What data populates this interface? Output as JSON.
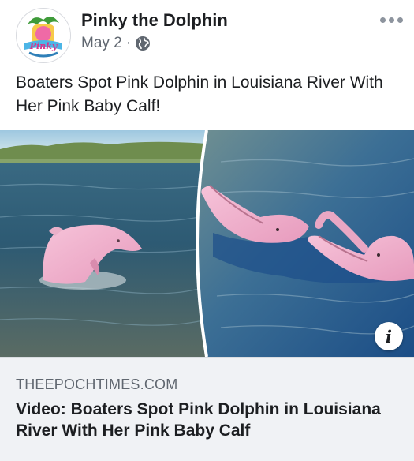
{
  "post": {
    "author": "Pinky the Dolphin",
    "date": "May 2",
    "separator": "·",
    "privacy_icon": "globe-icon",
    "more_icon": "more-options-icon",
    "avatar_text": "Pinky",
    "caption": "Boaters Spot Pink Dolphin in Louisiana River With Her Pink Baby Calf!"
  },
  "link": {
    "domain": "THEEPOCHTIMES.COM",
    "headline": "Video: Boaters Spot Pink Dolphin in Louisiana River With Her Pink Baby Calf",
    "info_label": "i",
    "info_icon": "info-icon"
  },
  "colors": {
    "text": "#1c1e21",
    "secondary": "#606770",
    "link_bg": "#f0f2f5",
    "dolphin_pink": "#f2b3cd"
  }
}
